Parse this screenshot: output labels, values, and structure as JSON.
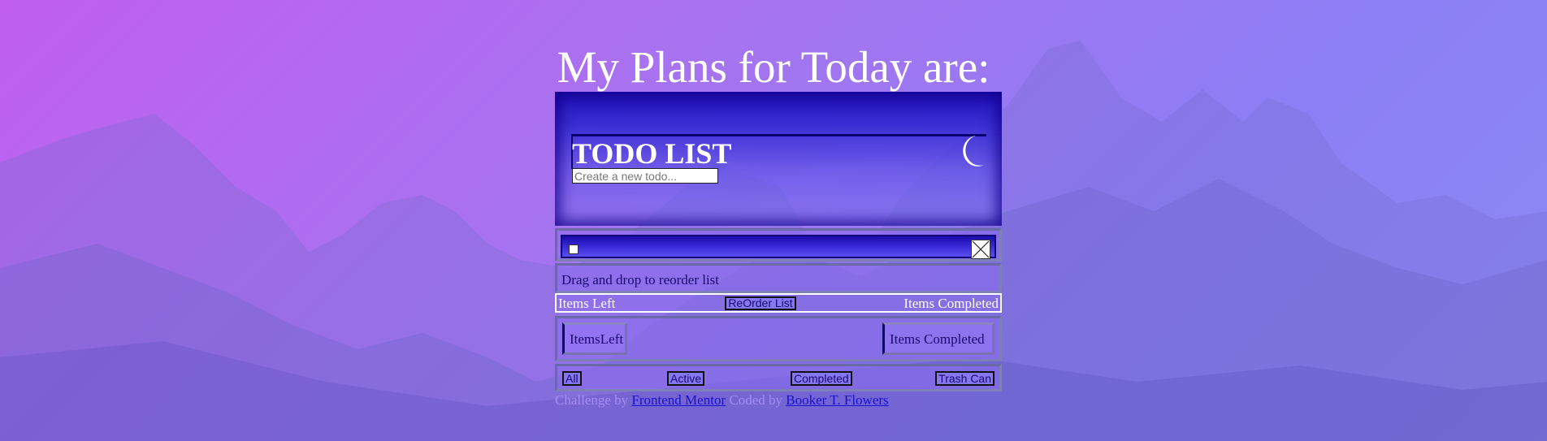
{
  "page": {
    "title": "My Plans for Today are:"
  },
  "header": {
    "app_title": "TODO LIST",
    "theme_toggle_icon": "moon-icon",
    "new_todo_placeholder": "Create a new todo..."
  },
  "todo_item": {
    "checkbox_icon": "checkbox-icon",
    "delete_icon": "close-icon"
  },
  "hint": {
    "drag_text": "Drag and drop to reorder list"
  },
  "info_bar": {
    "items_left_label": "Items Left",
    "reorder_label": "ReOrder List",
    "items_completed_label": "Items Completed"
  },
  "counts": {
    "left_label": "ItemsLeft",
    "completed_label": "Items Completed"
  },
  "filters": {
    "all": "All",
    "active": "Active",
    "completed": "Completed",
    "trash": "Trash Can"
  },
  "footer": {
    "prefix": "Challenge by",
    "mentor_link": "Frontend Mentor",
    "coded_by": "Coded by",
    "author_link": "Booker T. Flowers"
  },
  "colors": {
    "accent": "#1a0aa8",
    "text_dark": "#1a0a70",
    "link": "#1a10d0"
  }
}
